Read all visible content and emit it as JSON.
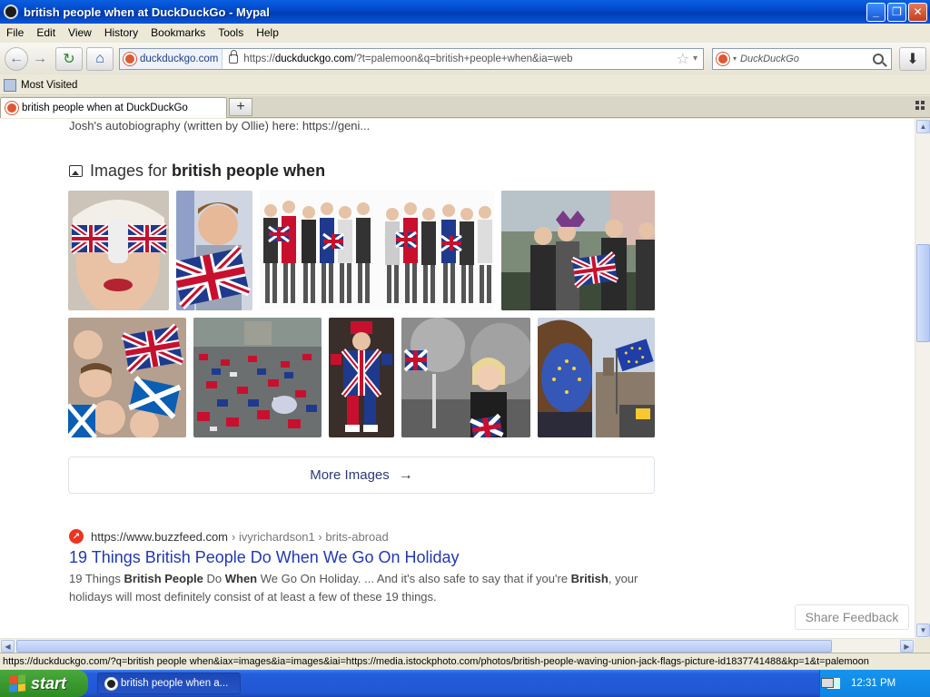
{
  "window": {
    "title": "british people when at DuckDuckGo - Mypal",
    "buttons": {
      "minimize": "_",
      "maximize": "❐",
      "close": "✕"
    }
  },
  "menu": [
    "File",
    "Edit",
    "View",
    "History",
    "Bookmarks",
    "Tools",
    "Help"
  ],
  "nav": {
    "identity_label": "duckduckgo.com",
    "url_scheme": "https://",
    "url_host": "duckduckgo.com",
    "url_rest": "/?t=palemoon&q=british+people+when&ia=web",
    "search_placeholder": "DuckDuckGo",
    "icons": {
      "back": "←",
      "forward": "→",
      "reload": "↻",
      "home": "⌂",
      "star": "☆",
      "dropdown": "▾",
      "download": "⬇"
    }
  },
  "bookmarks": {
    "most_visited": "Most Visited"
  },
  "tabs": [
    {
      "label": "british people when at DuckDuckGo"
    }
  ],
  "newtab_label": "+",
  "content": {
    "top_snippet": "Josh's autobiography (written by Ollie) here: https://geni...",
    "images_heading_prefix": "Images for",
    "images_heading_query": "british people when",
    "more_images": "More Images",
    "more_images_arrow": "→",
    "result": {
      "site": "https://www.buzzfeed.com",
      "path": "› ivyrichardson1 › brits-abroad",
      "title": "19 Things British People Do When We Go On Holiday",
      "snippet_parts": [
        "19 Things ",
        "British People",
        " Do ",
        "When",
        " We Go On Holiday. ... And it's also safe to say that if you're ",
        "British",
        ", your holidays will most definitely consist of at least a few of these 19 things."
      ]
    },
    "share_feedback": "Share Feedback"
  },
  "scroll": {
    "up": "▲",
    "down": "▼",
    "left": "◀",
    "right": "▶"
  },
  "status": "https://duckduckgo.com/?q=british people when&iax=images&ia=images&iai=https://media.istockphoto.com/photos/british-people-waving-union-jack-flags-picture-id1837741488&kp=1&t=palemoon",
  "taskbar": {
    "start": "start",
    "task_item": "british people when a...",
    "clock": "12:31 PM"
  }
}
